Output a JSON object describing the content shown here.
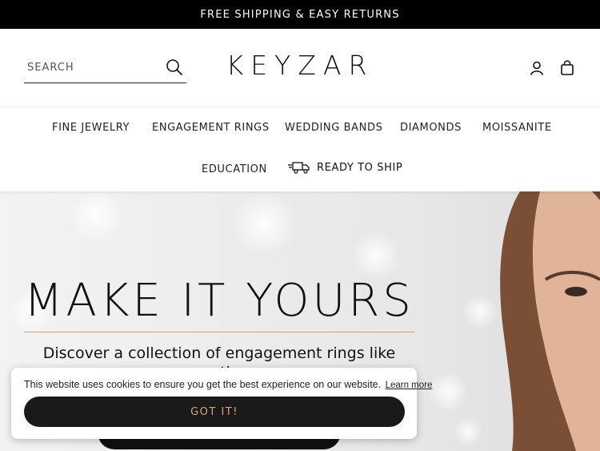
{
  "announcement": {
    "text": "FREE SHIPPING & EASY RETURNS"
  },
  "header": {
    "search_placeholder": "SEARCH",
    "logo": "KEYZAR",
    "icons": {
      "search": "search-icon",
      "account": "account-icon",
      "bag": "shopping-bag-icon"
    }
  },
  "nav": {
    "items": [
      "FINE JEWELRY",
      "ENGAGEMENT RINGS",
      "WEDDING BANDS",
      "DIAMONDS",
      "MOISSANITE",
      "EDUCATION",
      "READY TO SHIP"
    ],
    "ship_icon": "truck-icon"
  },
  "hero": {
    "title": "MAKE IT YOURS",
    "subtitle": "Discover a collection of engagement rings like no other",
    "accent_color": "#c9a27a"
  },
  "cookie": {
    "message": "This website uses cookies to ensure you get the best experience on our website.",
    "learn_more": "Learn more",
    "accept": "GOT IT!",
    "accept_text_color": "#d9a27b"
  }
}
